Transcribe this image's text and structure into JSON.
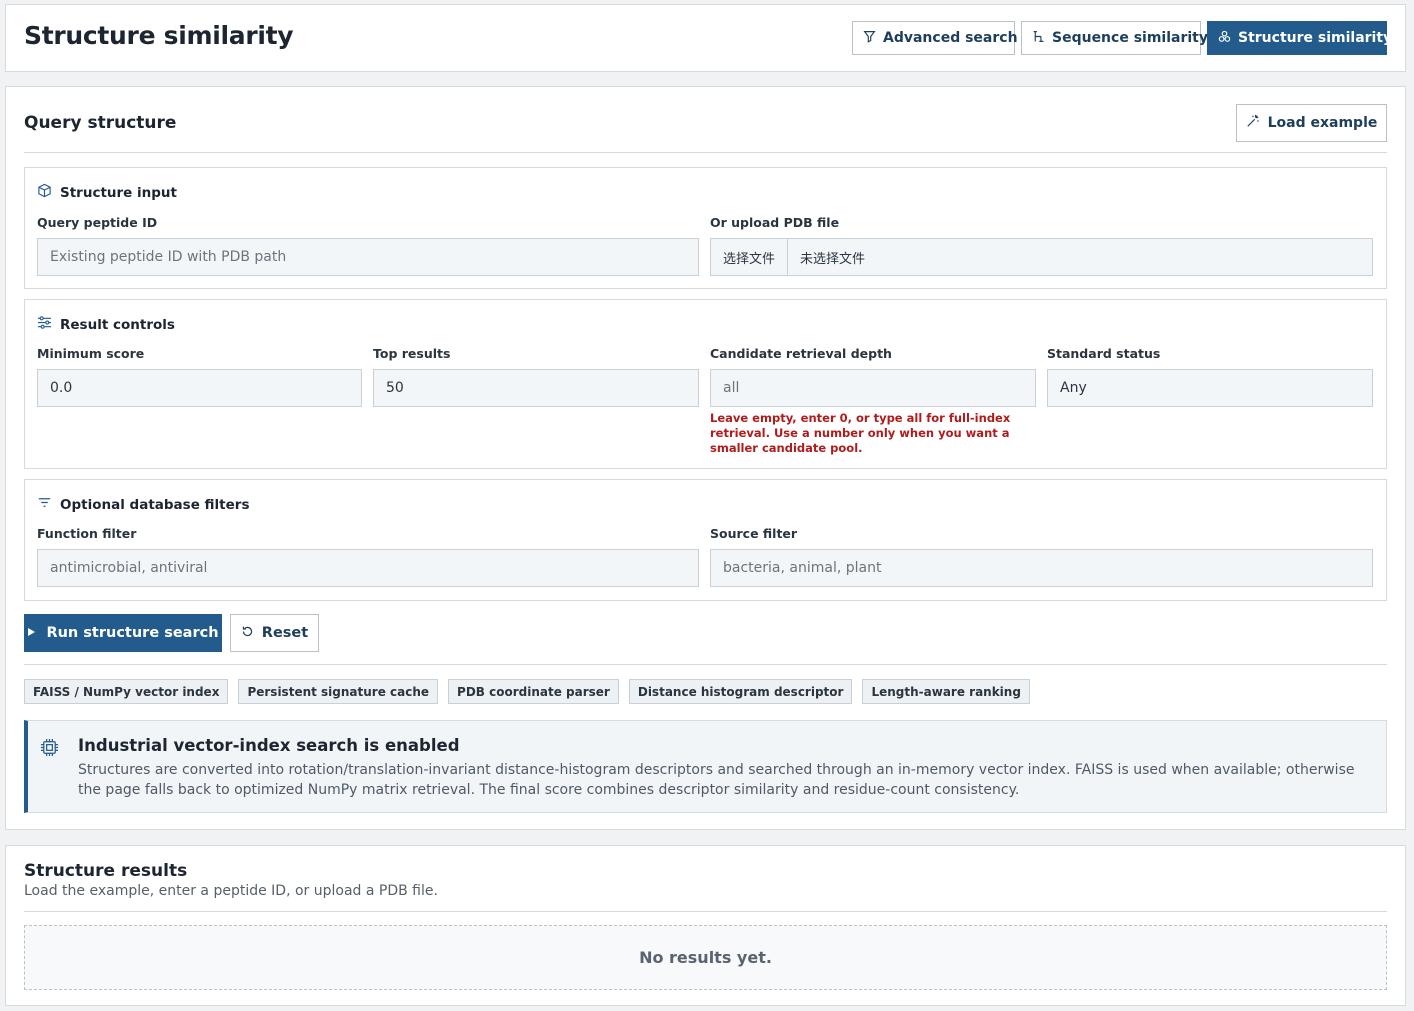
{
  "header": {
    "title": "Structure similarity",
    "nav": [
      {
        "label": "Advanced search",
        "icon": "filter-icon",
        "active": false
      },
      {
        "label": "Sequence similarity",
        "icon": "align-icon",
        "active": false
      },
      {
        "label": "Structure similarity",
        "icon": "molecule-icon",
        "active": true
      }
    ]
  },
  "query": {
    "title": "Query structure",
    "load_example": "Load example",
    "structure_input": {
      "heading": "Structure input",
      "peptide_label": "Query peptide ID",
      "peptide_placeholder": "Existing peptide ID with PDB path",
      "upload_label": "Or upload PDB file",
      "file_button": "选择文件",
      "file_name": "未选择文件"
    },
    "result_controls": {
      "heading": "Result controls",
      "min_score_label": "Minimum score",
      "min_score_value": "0.0",
      "top_results_label": "Top results",
      "top_results_value": "50",
      "depth_label": "Candidate retrieval depth",
      "depth_placeholder": "all",
      "depth_hint": "Leave empty, enter 0, or type all for full-index retrieval. Use a number only when you want a smaller candidate pool.",
      "status_label": "Standard status",
      "status_value": "Any"
    },
    "filters": {
      "heading": "Optional database filters",
      "function_label": "Function filter",
      "function_placeholder": "antimicrobial, antiviral",
      "source_label": "Source filter",
      "source_placeholder": "bacteria, animal, plant"
    },
    "run_label": "Run structure search",
    "reset_label": "Reset",
    "tags": [
      "FAISS / NumPy vector index",
      "Persistent signature cache",
      "PDB coordinate parser",
      "Distance histogram descriptor",
      "Length-aware ranking"
    ],
    "info": {
      "title": "Industrial vector-index search is enabled",
      "text": "Structures are converted into rotation/translation-invariant distance-histogram descriptors and searched through an in-memory vector index. FAISS is used when available; otherwise the page falls back to optimized NumPy matrix retrieval. The final score combines descriptor similarity and residue-count consistency."
    }
  },
  "results": {
    "title": "Structure results",
    "subtitle": "Load the example, enter a peptide ID, or upload a PDB file.",
    "empty": "No results yet."
  },
  "colors": {
    "accent": "#225b8c",
    "warning": "#b01c1c"
  }
}
